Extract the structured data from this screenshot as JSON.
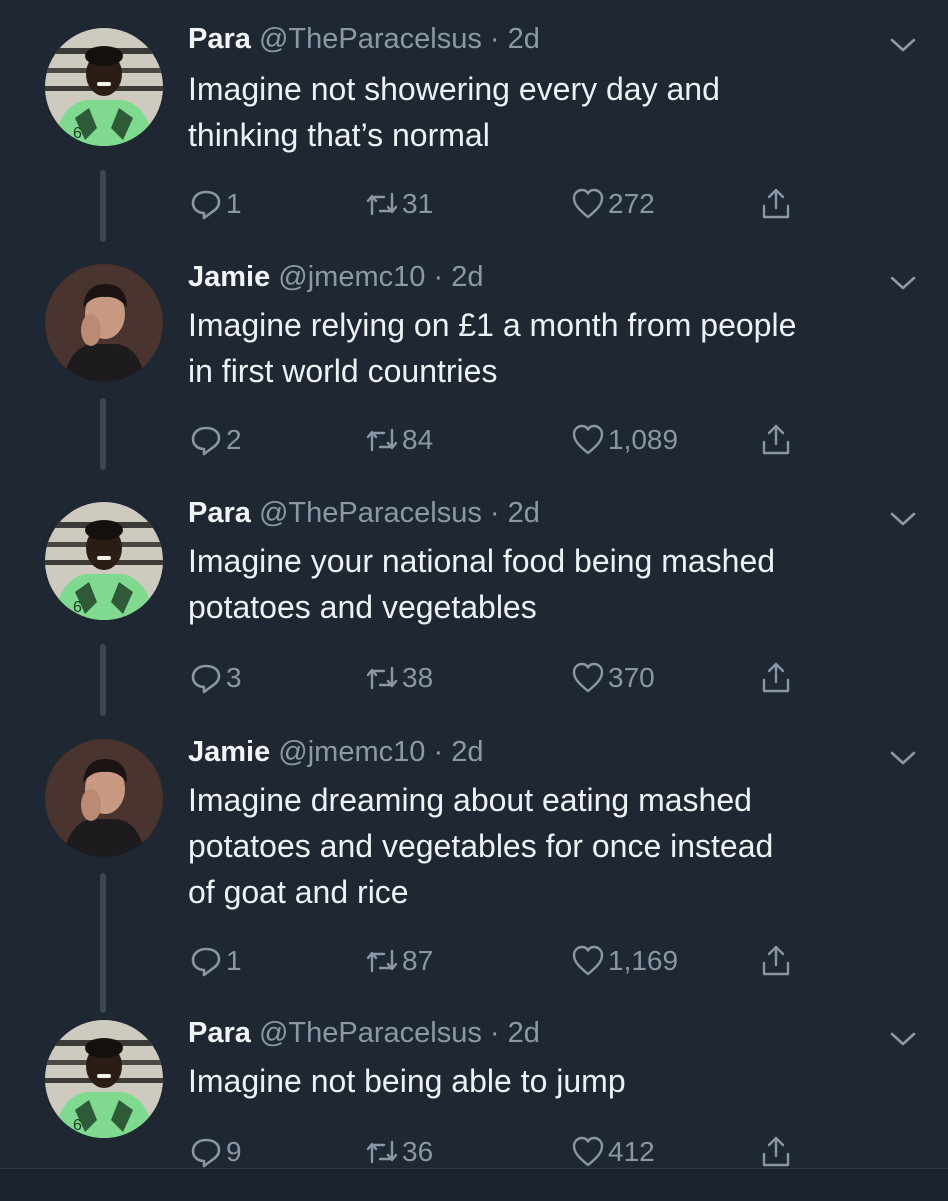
{
  "colors": {
    "background": "#1f2733",
    "secondary_text": "#8c98a7",
    "icon": "#8a96a5",
    "thread_line": "#3b4656"
  },
  "tweets": [
    {
      "name": "Para",
      "handle": "@TheParacelsus",
      "separator": "·",
      "time": "2d",
      "text_lines": [
        "Imagine not showering every day and",
        "thinking that’s normal"
      ],
      "replies": "1",
      "retweets": "31",
      "likes": "272",
      "avatar": "para-avatar"
    },
    {
      "name": "Jamie",
      "handle": "@jmemc10",
      "separator": "·",
      "time": "2d",
      "text_lines": [
        "Imagine relying on £1 a month from people",
        "in first world countries"
      ],
      "replies": "2",
      "retweets": "84",
      "likes": "1,089",
      "avatar": "jamie-avatar"
    },
    {
      "name": "Para",
      "handle": "@TheParacelsus",
      "separator": "·",
      "time": "2d",
      "text_lines": [
        "Imagine your national food being mashed",
        "potatoes and vegetables"
      ],
      "replies": "3",
      "retweets": "38",
      "likes": "370",
      "avatar": "para-avatar"
    },
    {
      "name": "Jamie",
      "handle": "@jmemc10",
      "separator": "·",
      "time": "2d",
      "text_lines": [
        "Imagine dreaming about eating mashed",
        "potatoes and vegetables for once instead",
        "of goat and rice"
      ],
      "replies": "1",
      "retweets": "87",
      "likes": "1,169",
      "avatar": "jamie-avatar"
    },
    {
      "name": "Para",
      "handle": "@TheParacelsus",
      "separator": "·",
      "time": "2d",
      "text_lines": [
        "Imagine not being able to jump"
      ],
      "replies": "9",
      "retweets": "36",
      "likes": "412",
      "avatar": "para-avatar"
    }
  ],
  "icons": {
    "reply": "reply-icon",
    "retweet": "retweet-icon",
    "like": "heart-icon",
    "share": "share-icon",
    "menu": "chevron-down-icon"
  }
}
